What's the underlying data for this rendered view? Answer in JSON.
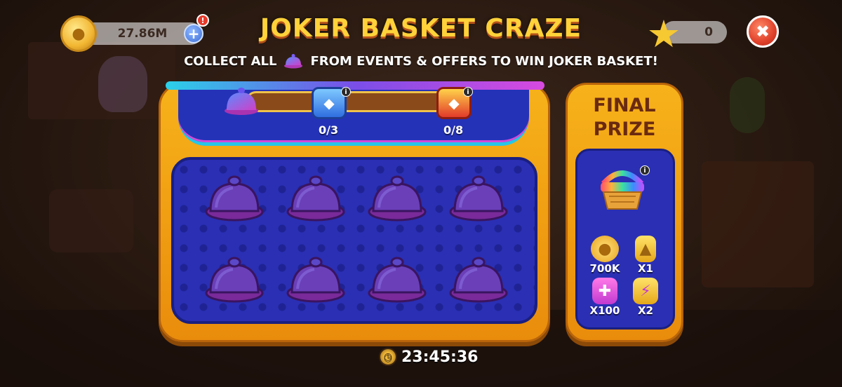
{
  "header": {
    "coins_value": "27.86M",
    "stars_value": "0",
    "coin_add_symbol": "+",
    "alert_symbol": "!",
    "close_symbol": "✖"
  },
  "event": {
    "title": "JOKER BASKET CRAZE",
    "subtitle_before": "COLLECT ALL",
    "subtitle_after": "FROM EVENTS & OFFERS TO WIN JOKER BASKET!"
  },
  "progress": {
    "collected_fraction": 0,
    "milestones": [
      {
        "label": "0/3",
        "icon": "blue-chest-icon"
      },
      {
        "label": "0/8",
        "icon": "red-chest-icon"
      }
    ]
  },
  "slots": {
    "count": 8,
    "filled": 0
  },
  "final_prize": {
    "title": "FINAL\nPRIZE",
    "rewards": [
      {
        "label": "700K",
        "icon": "coin-pile-icon"
      },
      {
        "label": "X1",
        "icon": "golden-ticket-icon"
      },
      {
        "label": "X100",
        "icon": "puzzle-piece-icon"
      },
      {
        "label": "X2",
        "icon": "lightning-puzzle-icon"
      }
    ]
  },
  "timer": {
    "value": "23:45:36"
  },
  "colors": {
    "title_yellow": "#ffd23a",
    "board_orange": "#f7b21a",
    "panel_blue": "#2a2fb4"
  }
}
